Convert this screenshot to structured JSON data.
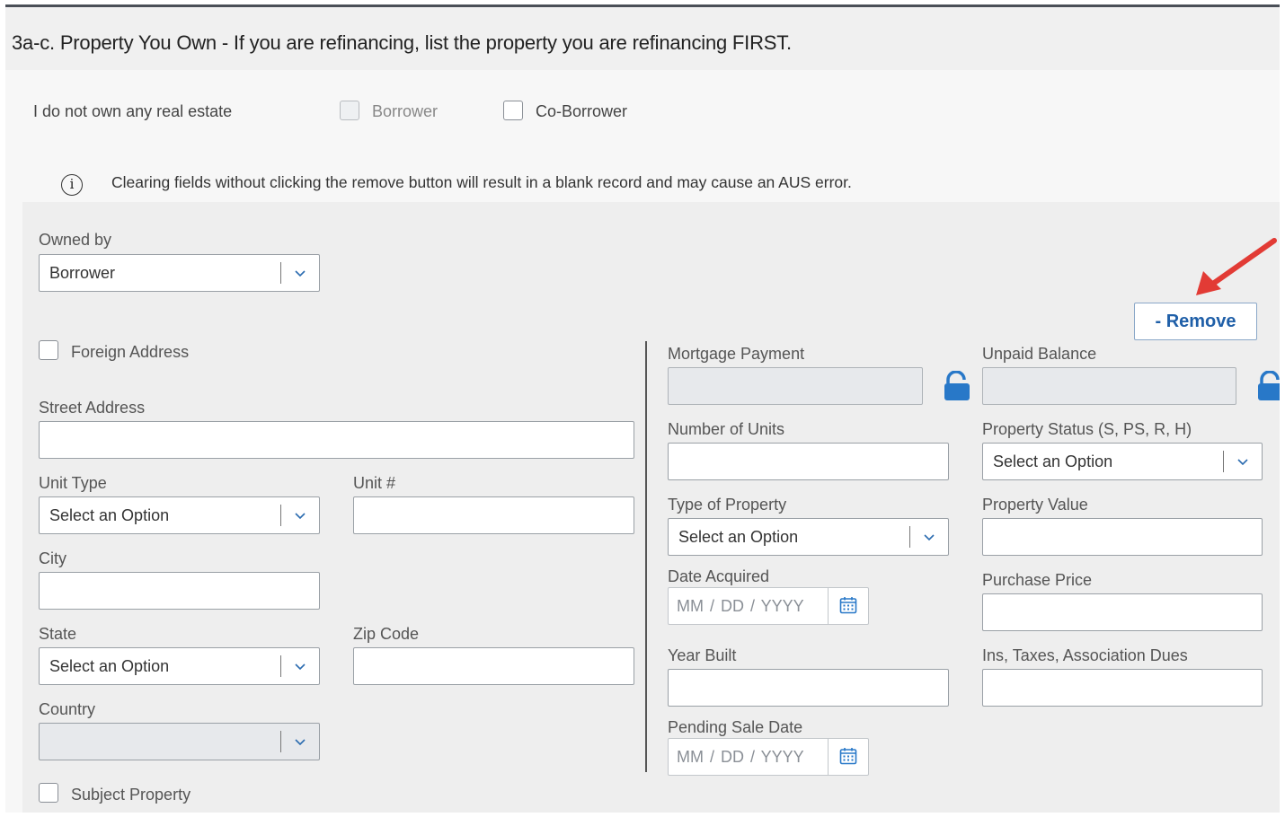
{
  "header": {
    "title": "3a-c. Property You Own - If you are refinancing, list the property you are refinancing FIRST."
  },
  "no_real_estate": {
    "label": "I do not own any real estate",
    "borrower_label": "Borrower",
    "coborrower_label": "Co-Borrower"
  },
  "info": {
    "icon": "info-circle-icon",
    "text": "Clearing fields without clicking the remove button will result in a blank record and may cause an AUS error."
  },
  "owned_by": {
    "label": "Owned by",
    "value": "Borrower"
  },
  "remove_button": {
    "label": "- Remove"
  },
  "left": {
    "foreign_address_label": "Foreign Address",
    "street_address_label": "Street Address",
    "unit_type_label": "Unit Type",
    "unit_type_value": "Select an Option",
    "unit_number_label": "Unit #",
    "city_label": "City",
    "state_label": "State",
    "state_value": "Select an Option",
    "zip_label": "Zip Code",
    "country_label": "Country",
    "subject_property_label": "Subject Property"
  },
  "middle": {
    "mortgage_payment_label": "Mortgage Payment",
    "number_of_units_label": "Number of Units",
    "type_of_property_label": "Type of Property",
    "type_of_property_value": "Select an Option",
    "date_acquired_label": "Date Acquired",
    "date_placeholder": "MM  /  DD  /  YYYY",
    "year_built_label": "Year Built",
    "pending_sale_date_label": "Pending Sale Date"
  },
  "right": {
    "unpaid_balance_label": "Unpaid Balance",
    "property_status_label": "Property Status (S, PS, R, H)",
    "property_status_value": "Select an Option",
    "property_value_label": "Property Value",
    "purchase_price_label": "Purchase Price",
    "ins_taxes_label": "Ins, Taxes, Association Dues"
  },
  "colors": {
    "accent": "#1f5fa8",
    "lock": "#2878c8",
    "arrow": "#e23b35"
  }
}
